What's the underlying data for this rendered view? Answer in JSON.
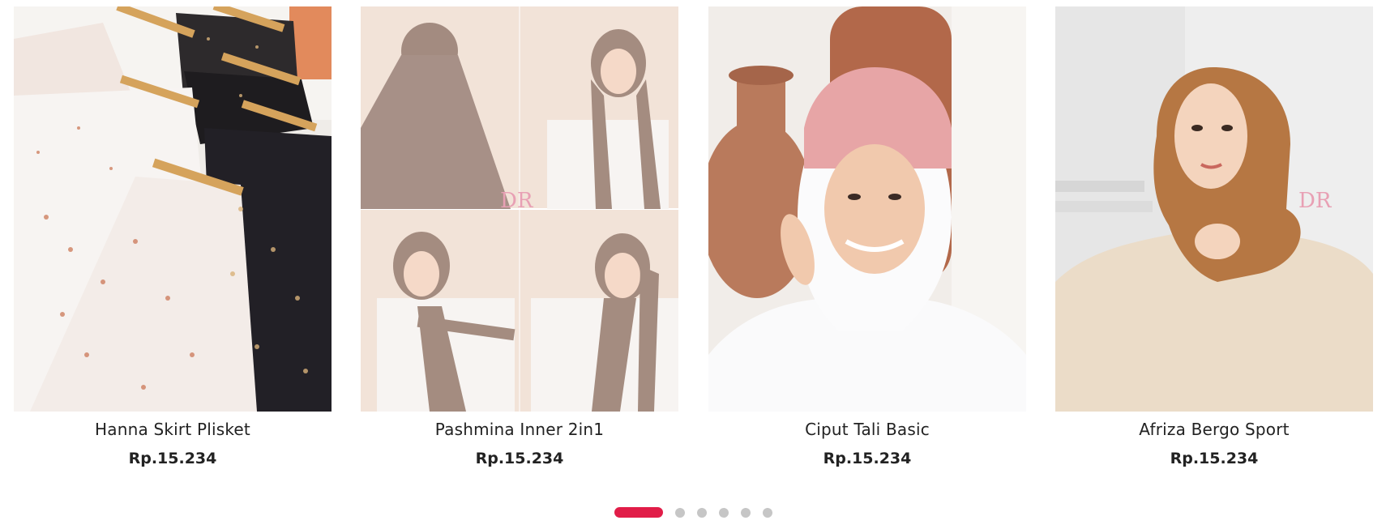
{
  "products": [
    {
      "name": "Hanna Skirt Plisket",
      "price": "Rp.15.234",
      "image": "floral-pleated-skirts-on-hangers"
    },
    {
      "name": "Pashmina Inner 2in1",
      "price": "Rp.15.234",
      "image": "pashmina-hijab-collage"
    },
    {
      "name": "Ciput Tali Basic",
      "price": "Rp.15.234",
      "image": "pink-inner-cap-model"
    },
    {
      "name": "Afriza Bergo Sport",
      "price": "Rp.15.234",
      "image": "caramel-sport-hijab-model"
    }
  ],
  "watermark": "DR",
  "pagination": {
    "count": 6,
    "active_index": 0,
    "active_color": "#e11d48",
    "inactive_color": "#c6c6c6"
  }
}
